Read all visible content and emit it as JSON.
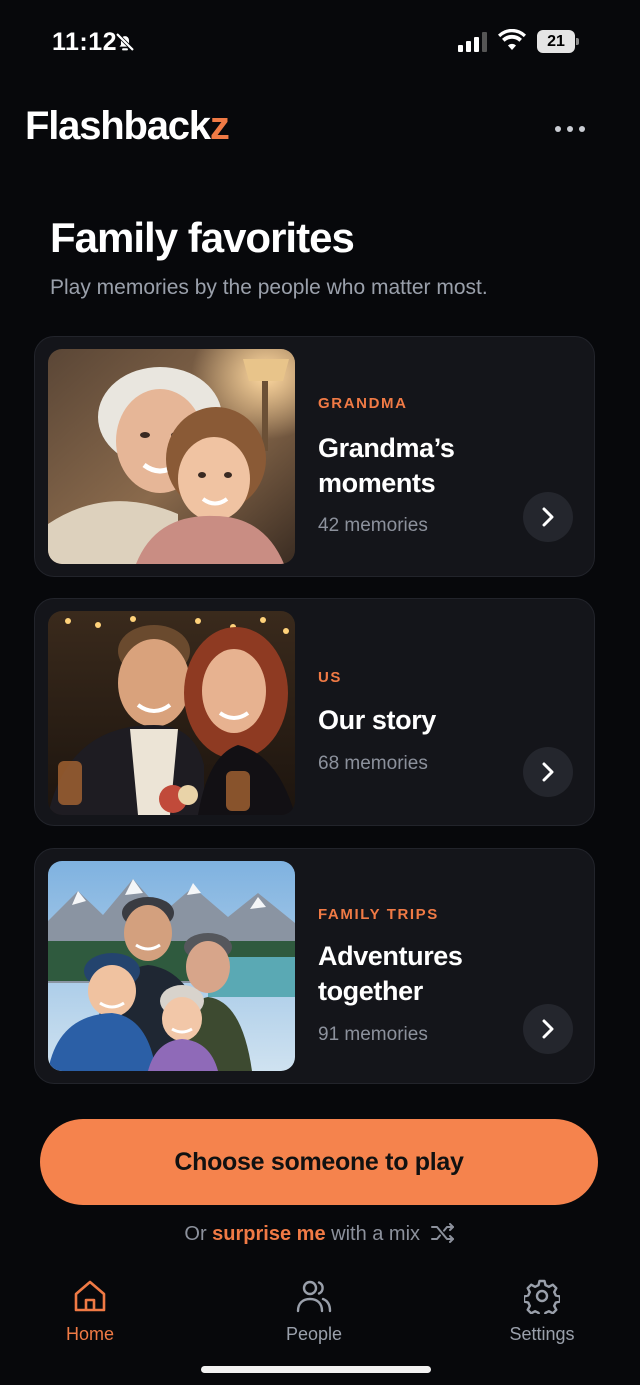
{
  "status_bar": {
    "time": "11:12",
    "battery": "21"
  },
  "app": {
    "logo_main": "Flashback",
    "logo_accent": "z"
  },
  "header": {
    "title": "Family favorites",
    "subtitle": "Play memories by the people who matter most."
  },
  "cards": [
    {
      "tag": "GRANDMA",
      "title": "Grandma’s moments",
      "count": "42 memories"
    },
    {
      "tag": "US",
      "title": "Our story",
      "count": "68 memories"
    },
    {
      "tag": "FAMILY TRIPS",
      "title": "Adventures together",
      "count": "91 memories"
    }
  ],
  "cta": {
    "label": "Choose someone to play"
  },
  "mix": {
    "prefix": "Or",
    "highlight": "surprise me",
    "suffix": "with a mix"
  },
  "tabs": [
    {
      "label": "Home",
      "active": true
    },
    {
      "label": "People",
      "active": false
    },
    {
      "label": "Settings",
      "active": false
    }
  ],
  "colors": {
    "accent": "#f07a45",
    "background": "#07080b",
    "card": "#14151a",
    "cta": "#f5834d"
  }
}
